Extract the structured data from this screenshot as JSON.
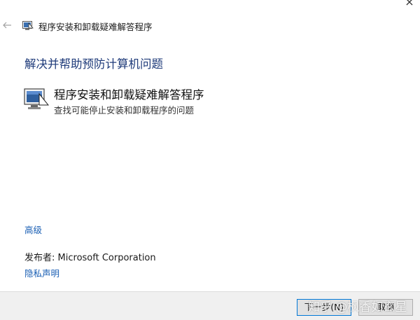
{
  "window": {
    "close_glyph": "×",
    "title": "程序安装和卸载疑难解答程序"
  },
  "main": {
    "heading": "解决并帮助预防计算机问题",
    "option": {
      "title": "程序安装和卸载疑难解答程序",
      "description": "查找可能停止安装和卸载程序的问题",
      "icon": "computer-icon"
    },
    "advanced_link": "高级",
    "publisher_label": "发布者:",
    "publisher_value": "Microsoft Corporation",
    "privacy_link": "隐私声明"
  },
  "footer": {
    "next_label": "下一步(N)",
    "cancel_label": "取消"
  },
  "watermark": "知乎 @枫香如玄星",
  "colors": {
    "heading": "#1f3b7a",
    "link": "#1a5fb4",
    "footer_bg": "#f0f0f0",
    "default_button_border": "#0078d7"
  }
}
